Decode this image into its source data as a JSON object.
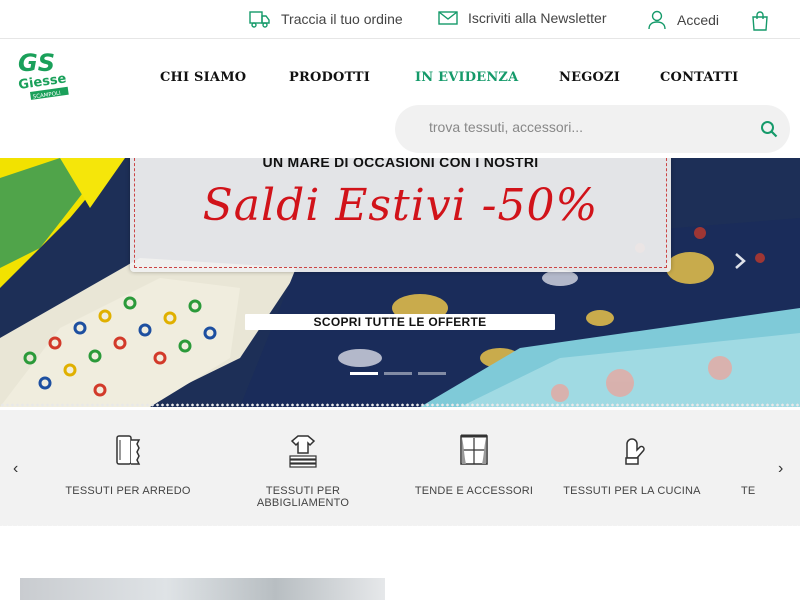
{
  "topbar": {
    "track_label": "Traccia il tuo ordine",
    "newsletter_label": "Iscriviti alla Newsletter",
    "login_label": "Accedi",
    "icons": [
      "truck-icon",
      "envelope-icon",
      "user-icon",
      "shopping-bag-icon"
    ]
  },
  "logo": {
    "mark": "GS",
    "name": "Giesse",
    "sub": "SCAMPOLI"
  },
  "nav": {
    "items": [
      {
        "label": "CHI SIAMO"
      },
      {
        "label": "PRODOTTI"
      },
      {
        "label": "IN EVIDENZA"
      },
      {
        "label": "NEGOZI"
      },
      {
        "label": "CONTATTI"
      }
    ],
    "active_index": 2
  },
  "search": {
    "placeholder": "trova tessuti, accessori..."
  },
  "hero": {
    "top_text": "UN MARE DI OCCASIONI CON I NOSTRI",
    "main_text": "Saldi Estivi -50%",
    "cta_label": "SCOPRI TUTTE LE OFFERTE",
    "slides_total": 3,
    "active_slide": 1
  },
  "categories": {
    "items": [
      {
        "label": "TESSUTI PER ARREDO",
        "icon": "fabric-roll-icon"
      },
      {
        "label": "TESSUTI PER ABBIGLIAMENTO",
        "icon": "clothes-icon"
      },
      {
        "label": "TENDE E ACCESSORI",
        "icon": "window-curtain-icon"
      },
      {
        "label": "TESSUTI PER LA CUCINA",
        "icon": "oven-mitt-icon"
      },
      {
        "label": "TE",
        "icon": ""
      }
    ]
  },
  "colors": {
    "accent": "#159a6a",
    "promo_red": "#d1131a",
    "hero_bg": "#1d2f57"
  }
}
